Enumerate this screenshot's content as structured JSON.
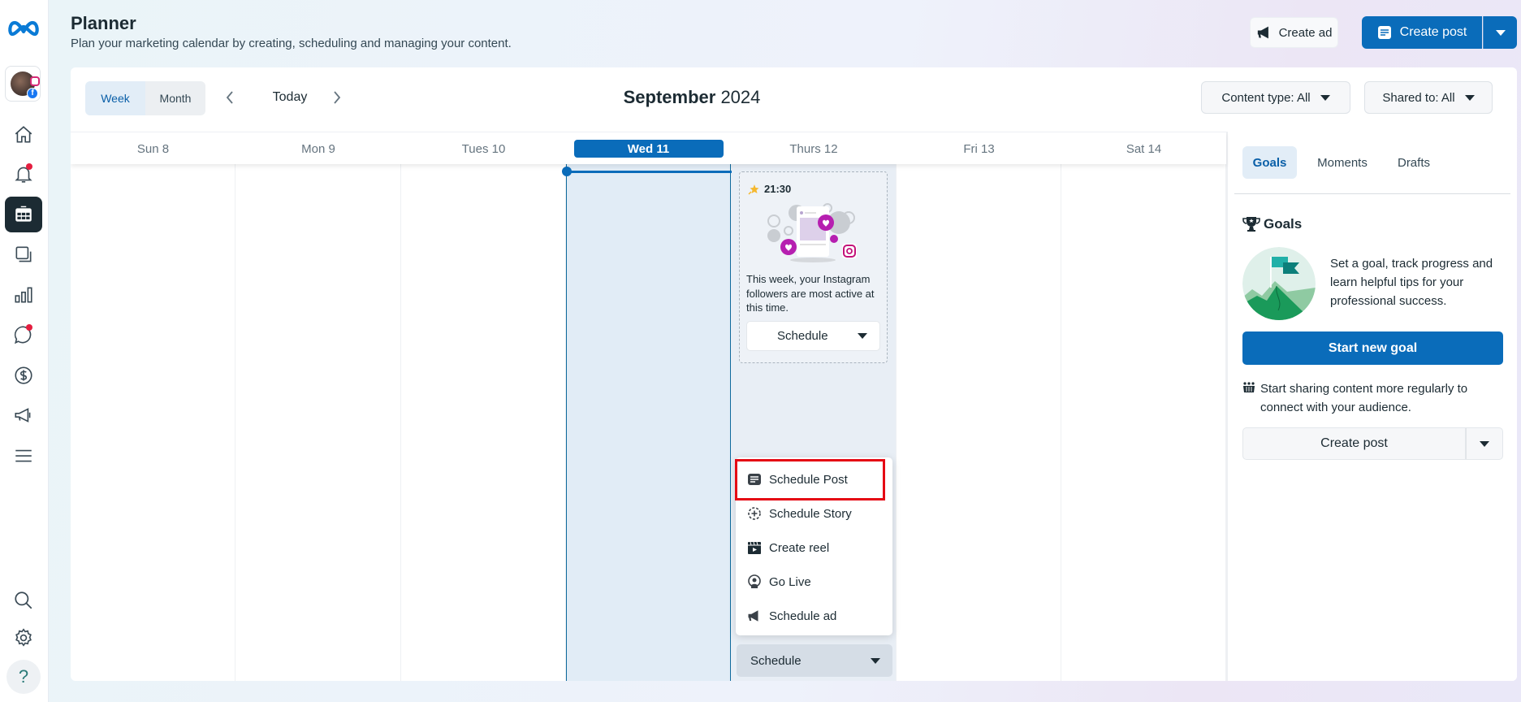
{
  "header": {
    "title": "Planner",
    "subtitle": "Plan your marketing calendar by creating, scheduling and managing your content.",
    "create_ad_label": "Create ad",
    "create_post_label": "Create post"
  },
  "leftnav": {
    "items": [
      {
        "name": "home",
        "badge": false,
        "active": false
      },
      {
        "name": "notifications",
        "badge": true,
        "active": false
      },
      {
        "name": "planner",
        "badge": false,
        "active": true
      },
      {
        "name": "content",
        "badge": false,
        "active": false
      },
      {
        "name": "insights",
        "badge": false,
        "active": false
      },
      {
        "name": "inbox",
        "badge": true,
        "active": false
      },
      {
        "name": "monetization",
        "badge": false,
        "active": false
      },
      {
        "name": "ads",
        "badge": false,
        "active": false
      },
      {
        "name": "all-tools",
        "badge": false,
        "active": false
      }
    ],
    "bottom": [
      "search",
      "settings",
      "help"
    ],
    "help_label": "?"
  },
  "toolbar": {
    "view_options": [
      "Week",
      "Month"
    ],
    "active_view": "Week",
    "today_label": "Today",
    "month_name": "September",
    "year": "2024",
    "filters": [
      {
        "label": "Content type: All"
      },
      {
        "label": "Shared to: All"
      }
    ]
  },
  "calendar": {
    "days": [
      {
        "label": "Sun 8",
        "today": false
      },
      {
        "label": "Mon 9",
        "today": false
      },
      {
        "label": "Tues 10",
        "today": false
      },
      {
        "label": "Wed 11",
        "today": true
      },
      {
        "label": "Thurs 12",
        "today": false
      },
      {
        "label": "Fri 13",
        "today": false
      },
      {
        "label": "Sat 14",
        "today": false
      }
    ],
    "suggestion": {
      "time": "21:30",
      "text": "This week, your Instagram followers are most active at this time.",
      "button_label": "Schedule"
    },
    "menu": {
      "items": [
        {
          "label": "Schedule Post",
          "icon": "post-icon",
          "highlighted": true
        },
        {
          "label": "Schedule Story",
          "icon": "story-icon",
          "highlighted": false
        },
        {
          "label": "Create reel",
          "icon": "reel-icon",
          "highlighted": false
        },
        {
          "label": "Go Live",
          "icon": "live-icon",
          "highlighted": false
        },
        {
          "label": "Schedule ad",
          "icon": "megaphone-icon",
          "highlighted": false
        }
      ]
    },
    "bottom_schedule_label": "Schedule"
  },
  "rightpanel": {
    "tabs": [
      "Goals",
      "Moments",
      "Drafts"
    ],
    "active_tab": "Goals",
    "goals_heading": "Goals",
    "goals_text": "Set a goal, track progress and learn helpful tips for your professional success.",
    "start_goal_label": "Start new goal",
    "tip_text": "Start sharing content more regularly to connect with your audience.",
    "create_post_label": "Create post"
  },
  "colors": {
    "accent": "#0a6cba",
    "highlight_border": "#e50914",
    "today_column": "#e1ecf6"
  }
}
